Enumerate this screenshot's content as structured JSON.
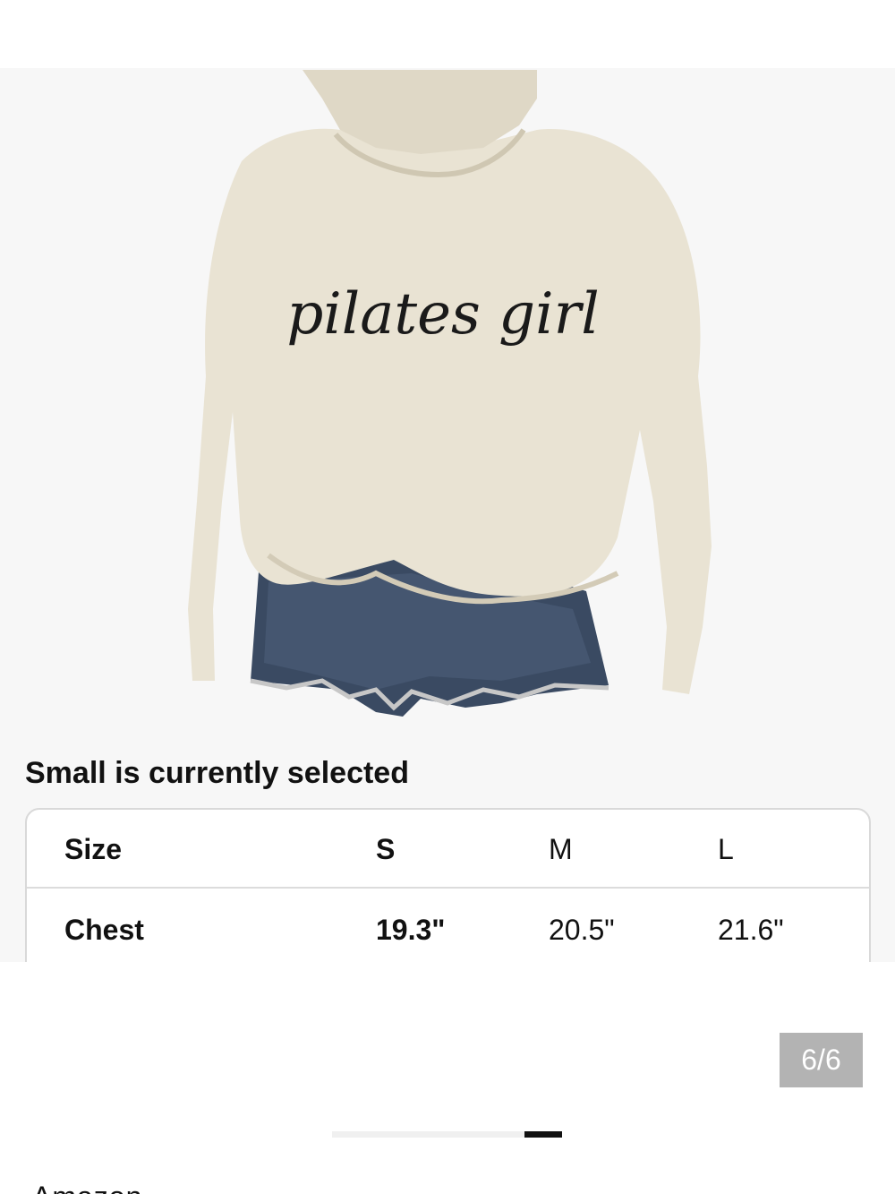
{
  "product": {
    "image_subject": "hoodie-with-denim-shorts",
    "print_text": "pilates girl",
    "colors": {
      "hoodie": "#e9e3d3",
      "denim": "#3a4a62",
      "print": "#1a1a1a",
      "panel": "#f7f7f7"
    }
  },
  "size_selection": {
    "caption": "Small is currently selected"
  },
  "size_table": {
    "header": {
      "label": "Size",
      "s": "S",
      "m": "M",
      "l": "L"
    },
    "rows": [
      {
        "label": "Chest",
        "s": "19.3\"",
        "m": "20.5\"",
        "l": "21.6\""
      }
    ]
  },
  "gallery": {
    "counter": "6/6",
    "position": 6,
    "total": 6
  },
  "seller": {
    "name_partial": "Amazon"
  }
}
